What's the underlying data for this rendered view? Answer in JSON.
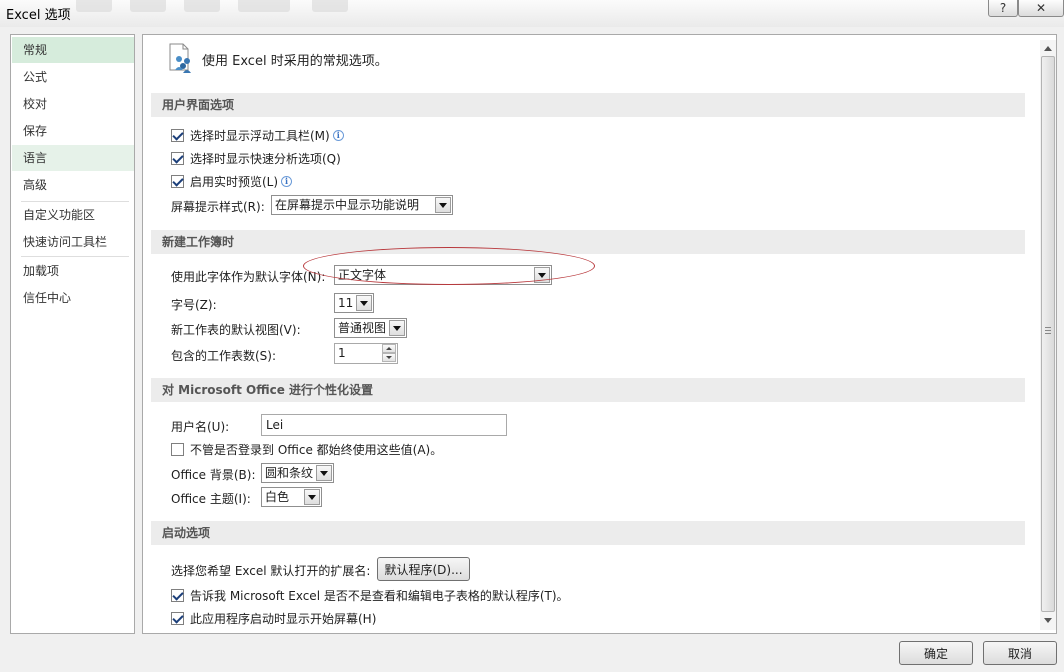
{
  "window": {
    "title": "Excel 选项",
    "help_label": "?",
    "close_label": "✕"
  },
  "sidebar": {
    "items": [
      {
        "label": "常规"
      },
      {
        "label": "公式"
      },
      {
        "label": "校对"
      },
      {
        "label": "保存"
      },
      {
        "label": "语言"
      },
      {
        "label": "高级"
      },
      {
        "label": "自定义功能区"
      },
      {
        "label": "快速访问工具栏"
      },
      {
        "label": "加载项"
      },
      {
        "label": "信任中心"
      }
    ],
    "selected": "常规"
  },
  "content": {
    "header_text": "使用 Excel 时采用的常规选项。",
    "ui_section": {
      "title": "用户界面选项",
      "mini_toolbar": {
        "label": "选择时显示浮动工具栏(M)",
        "checked": true
      },
      "quick_analysis": {
        "label": "选择时显示快速分析选项(Q)",
        "checked": true
      },
      "live_preview": {
        "label": "启用实时预览(L)",
        "checked": true
      },
      "screentip": {
        "label": "屏幕提示样式(R):",
        "value": "在屏幕提示中显示功能说明"
      }
    },
    "new_workbook_section": {
      "title": "新建工作簿时",
      "font": {
        "label": "使用此字体作为默认字体(N):",
        "value": "正文字体"
      },
      "font_size": {
        "label": "字号(Z):",
        "value": "11"
      },
      "default_view": {
        "label": "新工作表的默认视图(V):",
        "value": "普通视图"
      },
      "sheet_count": {
        "label": "包含的工作表数(S):",
        "value": "1"
      }
    },
    "personalize_section": {
      "title": "对 Microsoft Office 进行个性化设置",
      "username": {
        "label": "用户名(U):",
        "value": "Lei"
      },
      "always_use": {
        "label": "不管是否登录到 Office 都始终使用这些值(A)。",
        "checked": false
      },
      "background": {
        "label": "Office 背景(B):",
        "value": "圆和条纹"
      },
      "theme": {
        "label": "Office 主题(I):",
        "value": "白色"
      }
    },
    "startup_section": {
      "title": "启动选项",
      "extensions": {
        "label": "选择您希望 Excel 默认打开的扩展名:",
        "button": "默认程序(D)..."
      },
      "tell_me": {
        "label": "告诉我 Microsoft Excel 是否不是查看和编辑电子表格的默认程序(T)。",
        "checked": true
      },
      "start_screen": {
        "label": "此应用程序启动时显示开始屏幕(H)",
        "checked": true
      }
    }
  },
  "footer": {
    "ok_label": "确定",
    "cancel_label": "取消"
  },
  "colors": {
    "selected_nav": "#d6ecdc",
    "section_bg": "#ececec",
    "annotation_ellipse": "#b8383c"
  }
}
